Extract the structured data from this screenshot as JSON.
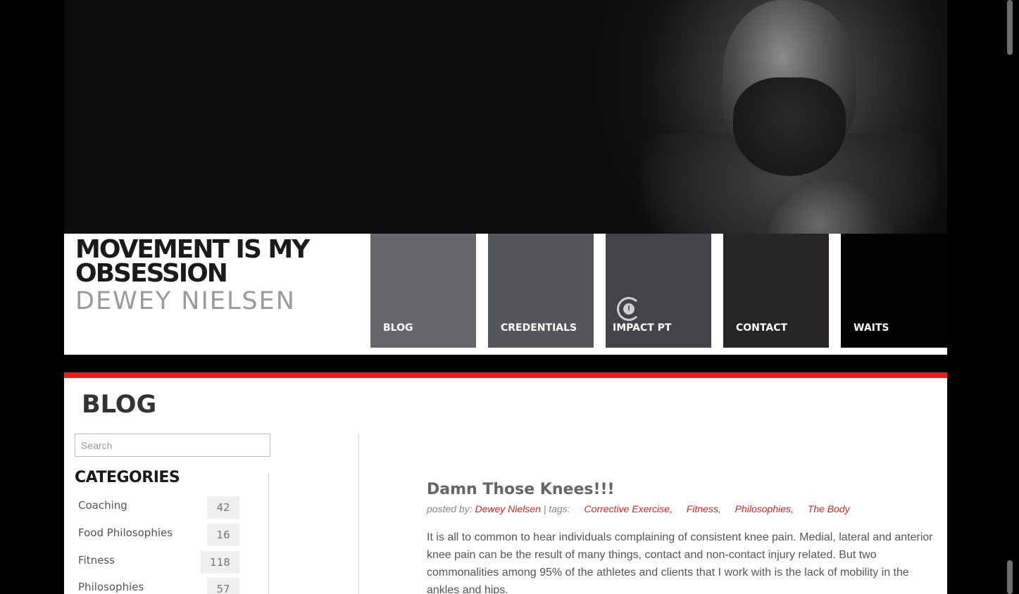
{
  "header": {
    "title_line": "MOVEMENT IS MY OBSESSION",
    "subtitle": "DEWEY NIELSEN"
  },
  "nav": {
    "items": [
      {
        "label": "BLOG",
        "color": "#66676b"
      },
      {
        "label": "CREDENTIALS",
        "color": "#55565a"
      },
      {
        "label": "IMPACT PT",
        "color": "#434447",
        "icon": "impact-pt-logo-icon"
      },
      {
        "label": "CONTACT",
        "color": "#272526"
      },
      {
        "label": "WAITS",
        "color": "#020202"
      }
    ]
  },
  "accent_color": "#e61e1e",
  "main": {
    "heading": "BLOG"
  },
  "search": {
    "placeholder": "Search"
  },
  "sidebar": {
    "categories_heading": "CATEGORIES",
    "categories": [
      {
        "label": "Coaching",
        "count": "42"
      },
      {
        "label": "Food Philosophies",
        "count": "16"
      },
      {
        "label": "Fitness",
        "count": "118"
      },
      {
        "label": "Philosophies",
        "count": "57"
      }
    ]
  },
  "post": {
    "title": "Damn Those Knees!!!",
    "posted_by_label": "posted by:",
    "author": "Dewey Nielsen",
    "tags_label": "| tags:",
    "tags": [
      "Corrective Exercise,",
      "Fitness,",
      "Philosophies,",
      "The Body"
    ],
    "body": "It is all to common to hear individuals complaining of consistent knee pain. Medial, lateral and anterior knee pain can be the result of many things, contact and non-contact injury related. But two commonalities among 95% of the athletes and clients that I work with is the lack of mobility in the ankles and hips."
  }
}
